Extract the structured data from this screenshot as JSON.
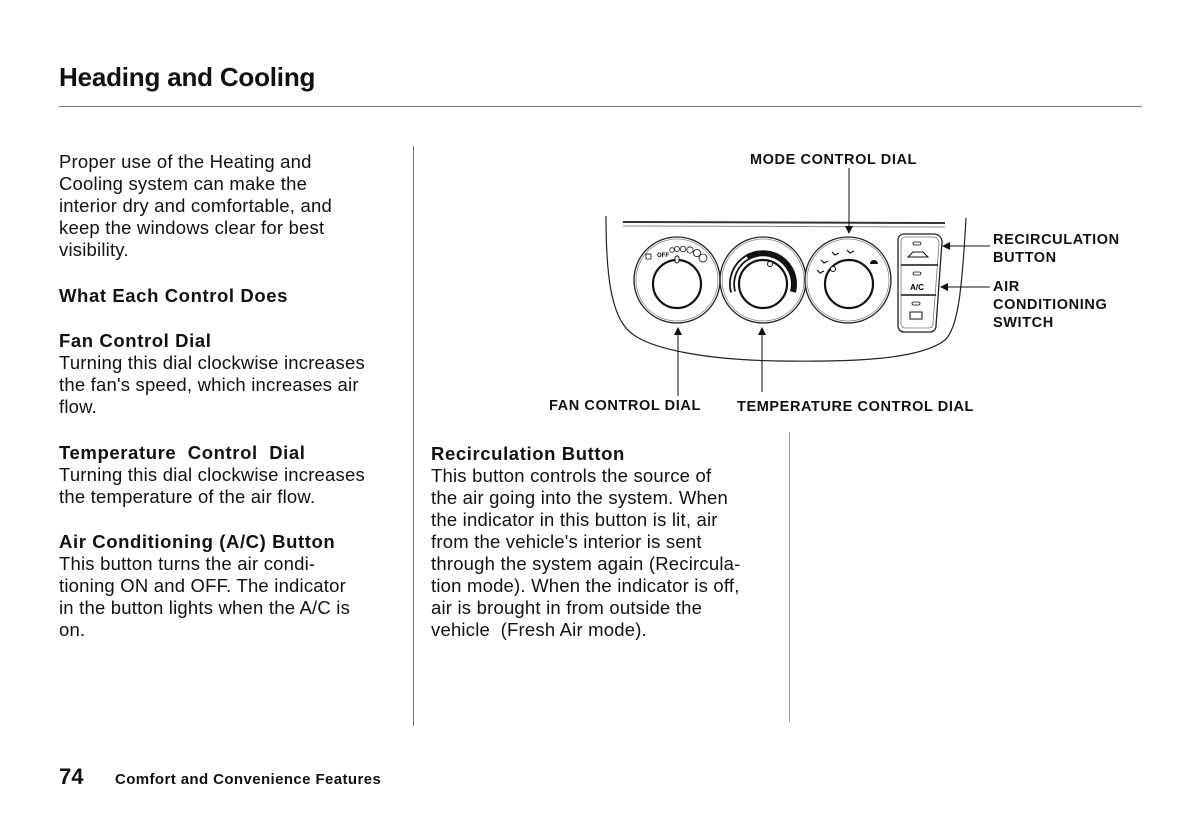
{
  "page": {
    "title": "Heading and Cooling",
    "number": "74",
    "section": "Comfort and Convenience Features"
  },
  "intro": {
    "lines": [
      "Proper use of the Heating and",
      "Cooling system can make the",
      "interior dry and comfortable, and",
      "keep the windows clear for best",
      "visibility."
    ]
  },
  "section_heading": "What Each Control Does",
  "controls": [
    {
      "title": "Fan Control Dial",
      "lines": [
        "Turning this dial clockwise increases",
        "the fan's speed, which increases air",
        "flow."
      ]
    },
    {
      "title": "Temperature  Control  Dial",
      "lines": [
        "Turning this dial clockwise increases",
        "the temperature of the air flow."
      ]
    },
    {
      "title": "Air Conditioning (A/C) Button",
      "lines": [
        "This button turns the air condi-",
        "tioning ON and OFF. The indicator",
        "in the button lights when the A/C is",
        "on."
      ]
    },
    {
      "title": "Recirculation Button",
      "lines": [
        "This button controls the source of",
        "the air going into the system. When",
        "the indicator in this button is lit, air",
        "from the vehicle's interior is sent",
        "through the system again (Recircula-",
        "tion mode). When the indicator is off,",
        "air is brought in from outside the",
        "vehicle  (Fresh Air mode)."
      ]
    }
  ],
  "diagram": {
    "labels": {
      "mode": "MODE CONTROL DIAL",
      "recirc_1": "RECIRCULATION",
      "recirc_2": "BUTTON",
      "ac_1": "AIR",
      "ac_2": "CONDITIONING",
      "ac_3": "SWITCH",
      "fan": "FAN CONTROL DIAL",
      "temp": "TEMPERATURE CONTROL DIAL"
    },
    "panel_text": {
      "ac_button": "A/C",
      "fan_off": "OFF"
    }
  }
}
